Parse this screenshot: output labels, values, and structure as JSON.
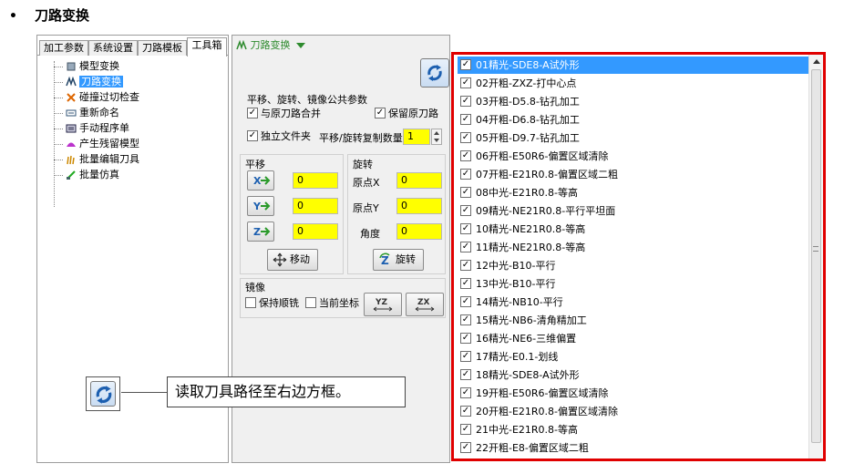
{
  "heading": {
    "bullet": "•",
    "title": "刀路变换"
  },
  "tabs": [
    "加工参数",
    "系统设置",
    "刀路模板",
    "工具箱"
  ],
  "tree": [
    {
      "label": "模型变换",
      "icon": "model-transform-icon"
    },
    {
      "label": "刀路变换",
      "icon": "toolpath-transform-icon",
      "selected": true
    },
    {
      "label": "碰撞过切检查",
      "icon": "collision-check-icon"
    },
    {
      "label": "重新命名",
      "icon": "rename-icon"
    },
    {
      "label": "手动程序单",
      "icon": "program-sheet-icon"
    },
    {
      "label": "产生残留模型",
      "icon": "residual-model-icon"
    },
    {
      "label": "批量编辑刀具",
      "icon": "batch-edit-tool-icon"
    },
    {
      "label": "批量仿真",
      "icon": "batch-simulation-icon"
    }
  ],
  "panel": {
    "title": "刀路变换",
    "common_group": "平移、旋转、镜像公共参数",
    "merge_original": "与原刀路合并",
    "keep_original": "保留原刀路",
    "independent_folder": "独立文件夹",
    "copy_count_label": "平移/旋转复制数量",
    "copy_count": "1",
    "translate_group": "平移",
    "x_value": "0",
    "y_value": "0",
    "z_value": "0",
    "move_button": "移动",
    "rotate_group": "旋转",
    "origin_x_label": "原点X",
    "origin_x": "0",
    "origin_y_label": "原点Y",
    "origin_y": "0",
    "angle_label": "角度",
    "angle": "0",
    "rotate_button": "旋转",
    "mirror_group": "镜像",
    "keep_climb": "保持顺铣",
    "current_coord": "当前坐标"
  },
  "toolpaths": [
    "01精光-SDE8-A试外形",
    "02开粗-ZXZ-打中心点",
    "03开粗-D5.8-钻孔加工",
    "04开粗-D6.8-钻孔加工",
    "05开粗-D9.7-钻孔加工",
    "06开粗-E50R6-偏置区域清除",
    "07开粗-E21R0.8-偏置区域二粗",
    "08中光-E21R0.8-等高",
    "09精光-NE21R0.8-平行平坦面",
    "10精光-NE21R0.8-等高",
    "11精光-NE21R0.8-等高",
    "12中光-B10-平行",
    "13中光-B10-平行",
    "14精光-NB10-平行",
    "15精光-NB6-清角精加工",
    "16精光-NE6-三维偏置",
    "17精光-E0.1-划线",
    "18精光-SDE8-A试外形",
    "19开粗-E50R6-偏置区域清除",
    "20开粗-E21R0.8-偏置区域清除",
    "21中光-E21R0.8-等高",
    "22开粗-E8-偏置区域二粗"
  ],
  "callout": {
    "text": "读取刀具路径至右边方框。"
  },
  "colors": {
    "accent_red": "#e00000",
    "selection": "#3399ff",
    "input_yellow": "#ffff00"
  }
}
